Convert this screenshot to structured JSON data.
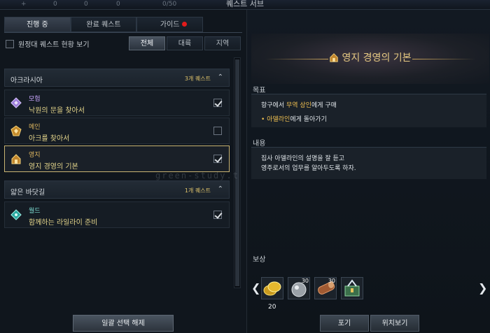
{
  "window": {
    "title": "퀘스트 서브",
    "top_left_a": "0",
    "top_left_b": "0",
    "top_left_c": "0",
    "top_counter": "0/50"
  },
  "tabs": [
    {
      "label": "진행 중",
      "active": true
    },
    {
      "label": "완료 퀘스트",
      "active": false
    },
    {
      "label": "가이드",
      "active": false,
      "badge": true
    }
  ],
  "expedition_toggle": {
    "label": "원정대 퀘스트 현황 보기",
    "checked": false
  },
  "filters": [
    {
      "label": "전체",
      "active": true
    },
    {
      "label": "대륙",
      "active": false
    },
    {
      "label": "지역",
      "active": false
    }
  ],
  "groups": [
    {
      "name": "아크라시아",
      "count": "3개 퀘스트",
      "quests": [
        {
          "type": "모험",
          "title": "낙원의 문을 찾아서",
          "checked": true,
          "selected": false,
          "icon": "adventure-diamond-icon",
          "color": "purple"
        },
        {
          "type": "메인",
          "title": "아크를 찾아서",
          "checked": false,
          "selected": false,
          "icon": "main-quest-icon",
          "color": "gold"
        },
        {
          "type": "영지",
          "title": "영지 경영의 기본",
          "checked": true,
          "selected": true,
          "icon": "estate-quest-icon",
          "color": "gold"
        }
      ]
    },
    {
      "name": "얇은 바닷길",
      "count": "1개 퀘스트",
      "quests": [
        {
          "type": "월드",
          "title": "함께하는 라일라이 준비",
          "checked": true,
          "selected": false,
          "icon": "world-quest-icon",
          "color": "cyan"
        }
      ]
    }
  ],
  "bottom_button": "일괄 선택 해제",
  "detail": {
    "title": "영지 경영의 기본",
    "goal_label": "목표",
    "goal_line1_pre": "항구에서 ",
    "goal_line1_hl": "무역 상인",
    "goal_line1_post": "에게 구매",
    "goal_line2_hl": "아델라인",
    "goal_line2_post": "에게 돌아가기",
    "content_label": "내용",
    "content_line1": "집사 아델라인의 설명을 잘 듣고",
    "content_line2": "영주로서의 업무를 알아두도록 하자.",
    "reward_label": "보상",
    "rewards": [
      {
        "icon": "gold-coins-icon",
        "qty": ""
      },
      {
        "icon": "silver-ore-icon",
        "qty": "30"
      },
      {
        "icon": "timber-log-icon",
        "qty": "30"
      },
      {
        "icon": "tool-kit-icon",
        "qty": ""
      }
    ],
    "gold_amount": "20",
    "give_up": "포기",
    "locate": "위치보기"
  },
  "watermark": "green-study.t"
}
